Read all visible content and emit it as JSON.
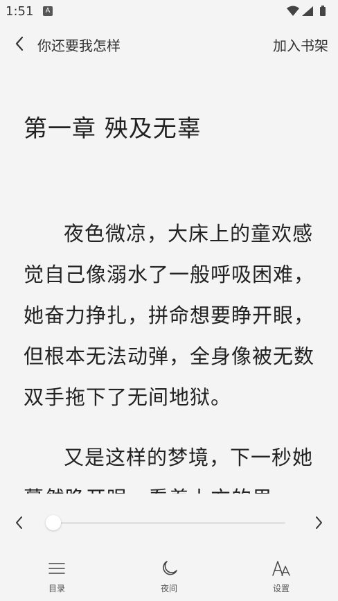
{
  "status_bar": {
    "time": "1:51",
    "notification_glyph": "A"
  },
  "header": {
    "book_title": "你还要我怎样",
    "add_to_shelf": "加入书架"
  },
  "chapter": {
    "title": "第一章  殃及无辜",
    "paragraphs": [
      "夜色微凉，大床上的童欢感觉自己像溺水了一般呼吸困难，她奋力挣扎，拼命想要睁开眼，但根本无法动弹，全身像被无数双手拖下了无间地狱。",
      "又是这样的梦境，下一秒她蓦然睁开眼，看着上方的男"
    ]
  },
  "reading_progress": {
    "fraction": 0.0
  },
  "bottom_nav": [
    {
      "label": "目录",
      "icon": "menu-icon"
    },
    {
      "label": "夜间",
      "icon": "moon-icon"
    },
    {
      "label": "设置",
      "icon": "font-settings-icon"
    }
  ],
  "colors": {
    "background": "#f4f4f4",
    "text": "#222222"
  }
}
